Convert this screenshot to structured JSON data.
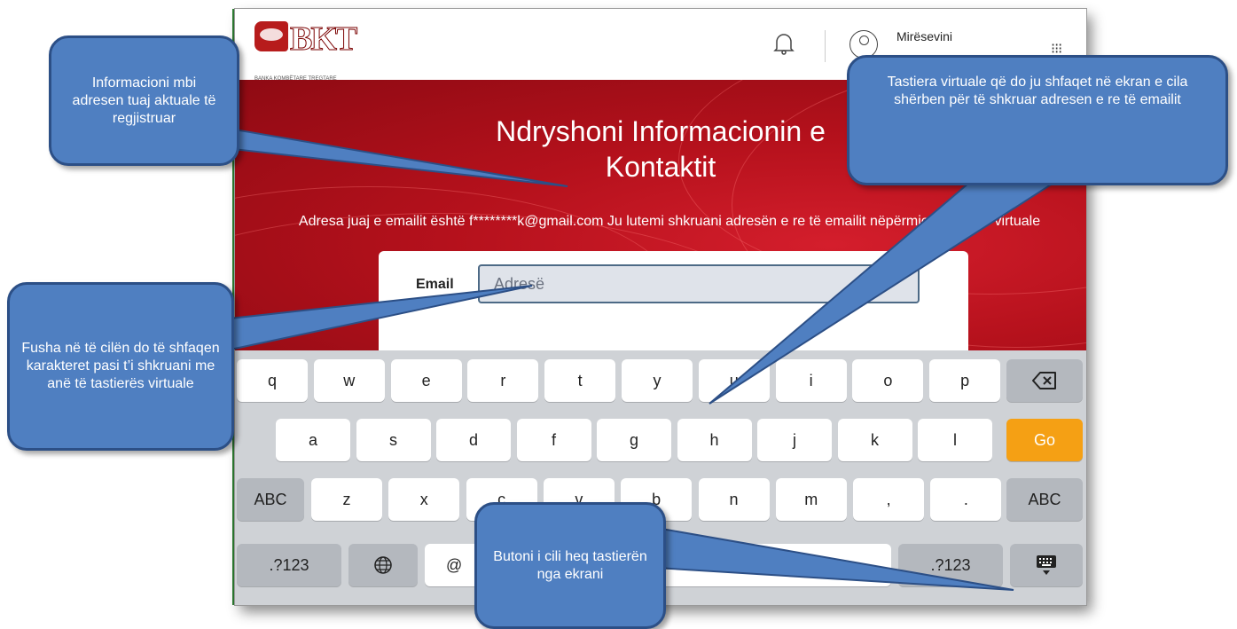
{
  "header": {
    "logo_text": "BKT",
    "logo_subtitle": "BANKA KOMBËTARE TREGTARE",
    "greeting": "Mirësevini",
    "icons": {
      "bell": "bell-icon",
      "avatar": "user-icon",
      "chevron": "chevron-down-icon",
      "apps": "grid-menu-icon"
    }
  },
  "page": {
    "title_line1": "Ndryshoni Informacionin e",
    "title_line2": "Kontaktit",
    "info_text": "Adresa juaj e emailit është f********k@gmail.com  Ju lutemi shkruani adresën e re të emailit nëpërmjet tastieres virtuale",
    "email_label": "Email",
    "email_placeholder": "Adresë",
    "email_value": ""
  },
  "keyboard": {
    "row1": [
      "q",
      "w",
      "e",
      "r",
      "t",
      "y",
      "u",
      "i",
      "o",
      "p"
    ],
    "row2": [
      "a",
      "s",
      "d",
      "f",
      "g",
      "h",
      "j",
      "k",
      "l"
    ],
    "go_label": "Go",
    "row3": [
      "z",
      "x",
      "c",
      "v",
      "b",
      "n",
      "m",
      ",",
      "."
    ],
    "abc_label": "ABC",
    "num_label": ".?123",
    "at_label": "@",
    "icons": {
      "backspace": "backspace-icon",
      "globe": "globe-icon",
      "hide": "keyboard-hide-icon"
    }
  },
  "callouts": {
    "current_email": "Informacioni mbi adresen tuaj aktuale të regjistruar",
    "virtual_keyboard": "Tastiera virtuale që do ju shfaqet në ekran e cila shërben për të shkruar adresen e re të emailit",
    "input_field": "Fusha në të cilën do të shfaqen karakteret pasi t’i shkruani me anë të tastierës virtuale",
    "hide_button": "Butoni i cili heq tastierën nga ekrani"
  },
  "colors": {
    "brand_red": "#b5111c",
    "go_key": "#f5a014",
    "callout_blue": "#4f7fc1"
  }
}
